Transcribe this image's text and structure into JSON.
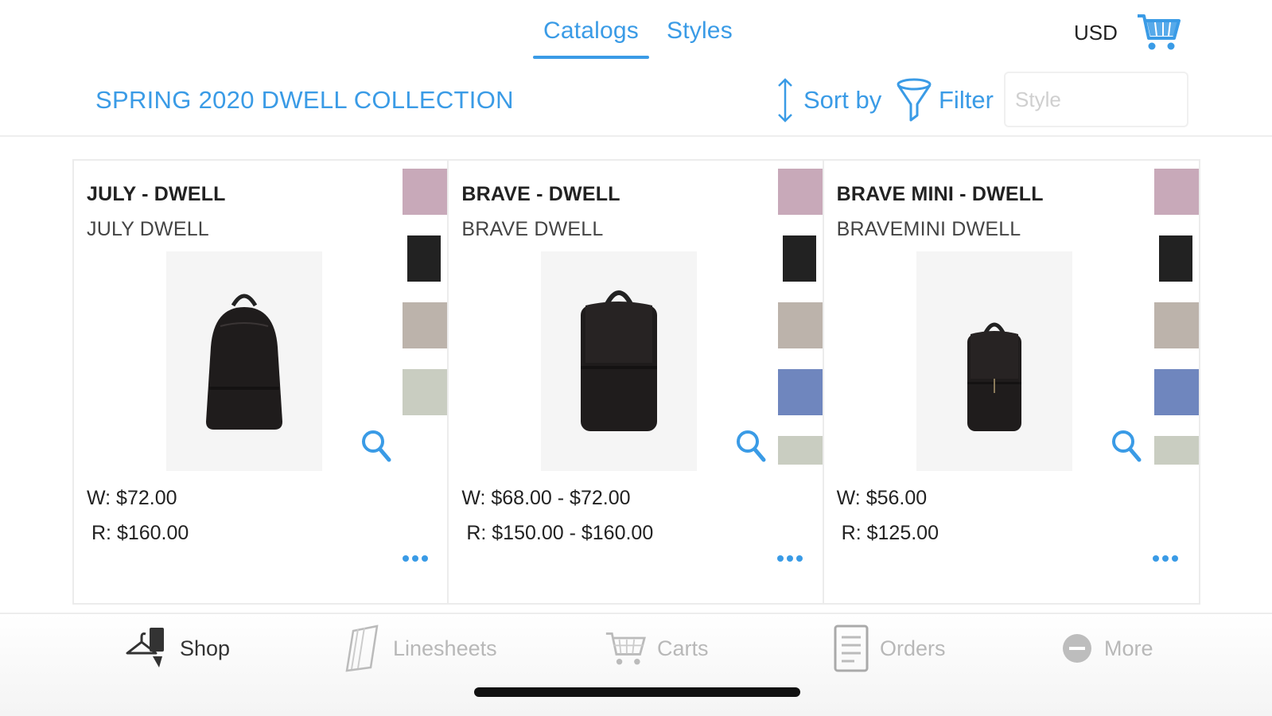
{
  "top_tabs": [
    {
      "label": "Catalogs",
      "active": true
    },
    {
      "label": "Styles",
      "active": false
    }
  ],
  "currency": "USD",
  "colors": {
    "accent": "#3a9be6",
    "text": "#222222",
    "inactive": "#b8b8b8"
  },
  "collection_title": "SPRING 2020 DWELL COLLECTION",
  "toolbar": {
    "sort_label": "Sort by",
    "filter_label": "Filter",
    "search_placeholder": "Style"
  },
  "products": [
    {
      "title": "JULY - DWELL",
      "subtitle": "JULY DWELL",
      "wholesale": "W: $72.00",
      "retail": "R: $160.00",
      "swatches": [
        "#c8a9b9",
        "#222222",
        "#bcb3ab",
        "#c9cdc1"
      ]
    },
    {
      "title": "BRAVE - DWELL",
      "subtitle": "BRAVE DWELL",
      "wholesale": "W: $68.00 - $72.00",
      "retail": "R: $150.00 - $160.00",
      "swatches": [
        "#c8a9b9",
        "#222222",
        "#bcb3ab",
        "#6f86be",
        "#c9cdc1"
      ]
    },
    {
      "title": "BRAVE MINI - DWELL",
      "subtitle": "BRAVEMINI DWELL",
      "wholesale": "W: $56.00",
      "retail": "R: $125.00",
      "swatches": [
        "#c8a9b9",
        "#222222",
        "#bcb3ab",
        "#6f86be",
        "#c9cdc1"
      ]
    }
  ],
  "bottom_nav": [
    {
      "label": "Shop",
      "icon": "shop-hanger-icon",
      "active": true
    },
    {
      "label": "Linesheets",
      "icon": "linesheets-icon",
      "active": false
    },
    {
      "label": "Carts",
      "icon": "cart-icon",
      "active": false
    },
    {
      "label": "Orders",
      "icon": "orders-icon",
      "active": false
    },
    {
      "label": "More",
      "icon": "more-icon",
      "active": false
    }
  ]
}
